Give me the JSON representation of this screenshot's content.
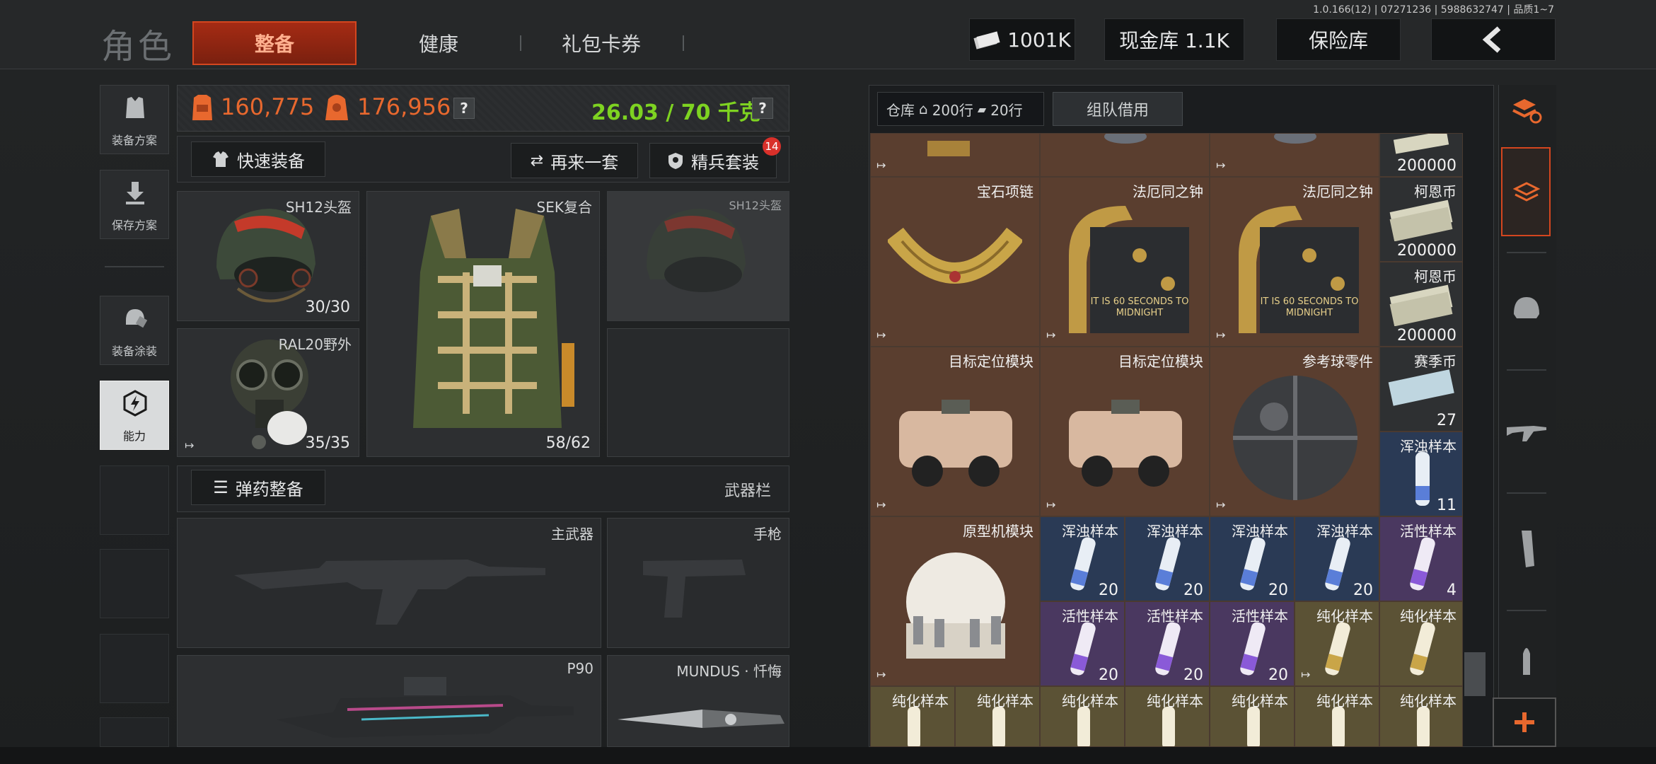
{
  "header": {
    "title": "角色",
    "tabs": [
      {
        "label": "整备"
      },
      {
        "label": "健康"
      },
      {
        "label": "礼包卡券"
      }
    ],
    "version": "1.0.166(12) | 07271236 | 5988632747 | 品质1~7",
    "currency": "1001K",
    "cash_vault": "现金库 1.1K",
    "insurance": "保险库"
  },
  "sidebar": {
    "items": [
      {
        "label": "装备方案"
      },
      {
        "label": "保存方案"
      },
      {
        "label": "装备涂装"
      },
      {
        "label": "能力"
      }
    ]
  },
  "stats": {
    "value1": "160,775",
    "value2": "176,956",
    "weight": "26.03 / 70 千克",
    "help": "?"
  },
  "actions": {
    "quick_equip": "快速装备",
    "again": "再来一套",
    "elite": "精兵套装",
    "elite_badge": "14"
  },
  "gear": {
    "helmet": {
      "label": "SH12头盔",
      "count": "30/30"
    },
    "armor": {
      "label": "SEK复合",
      "count": "58/62"
    },
    "helmet_ghost": {
      "label": "SH12头盔"
    },
    "mask": {
      "label": "RAL20野外",
      "count": "35/35"
    }
  },
  "ammo": {
    "button": "弹药整备",
    "weapon_bar": "武器栏"
  },
  "weapons": {
    "primary": "主武器",
    "pistol": "手枪",
    "p90": "P90",
    "knife": "MUNDUS · 忏悔"
  },
  "storage": {
    "tab_label": "仓库",
    "rows": "200行",
    "rows2": "20行",
    "team_loan": "组队借用",
    "items": [
      {
        "name": "",
        "count": "200000"
      },
      {
        "name": "宝石项链"
      },
      {
        "name": "法厄同之钟"
      },
      {
        "name": "法厄同之钟"
      },
      {
        "name": "柯恩币",
        "count": "200000"
      },
      {
        "name": "柯恩币",
        "count": "200000"
      },
      {
        "name": "目标定位模块"
      },
      {
        "name": "目标定位模块"
      },
      {
        "name": "参考球零件"
      },
      {
        "name": "赛季币",
        "count": "27"
      },
      {
        "name": "浑浊样本",
        "count": "11"
      },
      {
        "name": "原型机模块"
      },
      {
        "name": "浑浊样本",
        "count": "20"
      },
      {
        "name": "浑浊样本",
        "count": "20"
      },
      {
        "name": "浑浊样本",
        "count": "20"
      },
      {
        "name": "浑浊样本",
        "count": "20"
      },
      {
        "name": "活性样本",
        "count": "4"
      },
      {
        "name": "活性样本",
        "count": "20"
      },
      {
        "name": "活性样本",
        "count": "20"
      },
      {
        "name": "活性样本",
        "count": "20"
      },
      {
        "name": "纯化样本"
      },
      {
        "name": "纯化样本"
      },
      {
        "name": "纯化样本"
      },
      {
        "name": "纯化样本"
      },
      {
        "name": "纯化样本"
      },
      {
        "name": "纯化样本"
      },
      {
        "name": "纯化样本"
      },
      {
        "name": "纯化样本"
      },
      {
        "name": "纯化样本"
      }
    ],
    "clock_text": "IT IS 60 SECONDS TO MIDNIGHT"
  },
  "colors": {
    "accent": "#d4461f",
    "stat_orange": "#e8682e",
    "weight_green": "#7ed321"
  }
}
